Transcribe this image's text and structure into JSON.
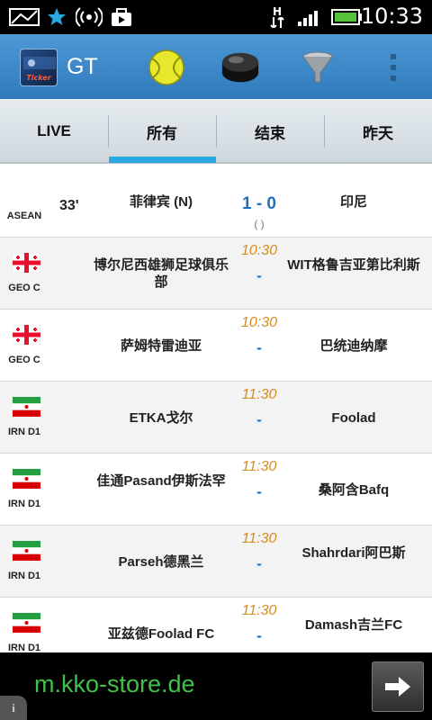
{
  "statusbar": {
    "time": "10:33",
    "icons": [
      "image-icon",
      "star-icon",
      "hotspot-icon",
      "briefcase-icon",
      "data-transfer-icon",
      "signal-icon",
      "battery-icon"
    ],
    "network_letter": "H"
  },
  "appbar": {
    "title": "GT",
    "logo_text": "Ticker",
    "actions": [
      "tennis-ball-icon",
      "hockey-puck-icon",
      "filter-icon",
      "overflow-menu-icon"
    ]
  },
  "tabs": [
    {
      "label": "LIVE",
      "selected": false
    },
    {
      "label": "所有",
      "selected": true
    },
    {
      "label": "结束",
      "selected": false
    },
    {
      "label": "昨天",
      "selected": false
    }
  ],
  "matches": [
    {
      "league": "ASEAN",
      "flag": "",
      "minute": "33'",
      "home": "菲律宾 (N)",
      "away": "印尼",
      "score": "1 - 0",
      "subscore": "( )",
      "time": ""
    },
    {
      "league": "GEO C",
      "flag": "georgia",
      "minute": "",
      "home": "博尔尼西雄狮足球俱乐部",
      "away": "WIT格鲁吉亚第比利斯",
      "score": "",
      "subscore": "",
      "time": "10:30",
      "dash": "-"
    },
    {
      "league": "GEO C",
      "flag": "georgia",
      "minute": "",
      "home": "萨姆特雷迪亚",
      "away": "巴统迪纳摩",
      "score": "",
      "subscore": "",
      "time": "10:30",
      "dash": "-"
    },
    {
      "league": "IRN D1",
      "flag": "iran",
      "minute": "",
      "home": "ETKA戈尔",
      "away": "Foolad",
      "score": "",
      "subscore": "",
      "time": "11:30",
      "dash": "-"
    },
    {
      "league": "IRN D1",
      "flag": "iran",
      "minute": "",
      "home": "佳通Pasand伊斯法罕",
      "away": "桑阿含Bafq",
      "score": "",
      "subscore": "",
      "time": "11:30",
      "dash": "-"
    },
    {
      "league": "IRN D1",
      "flag": "iran",
      "minute": "",
      "home": "Parseh德黑兰",
      "away": "Shahrdari阿巴斯",
      "score": "",
      "subscore": "",
      "time": "11:30",
      "dash": "-"
    },
    {
      "league": "IRN D1",
      "flag": "iran",
      "minute": "",
      "home": "亚兹德Foolad FC",
      "away": "Damash吉兰FC",
      "score": "",
      "subscore": "",
      "time": "11:30",
      "dash": "-"
    }
  ],
  "ad": {
    "text": "m.kko-store.de",
    "info": "i"
  },
  "colors": {
    "appbar": "#3a86c8",
    "tab_indicator": "#2aa9e0",
    "score": "#1f6fc0",
    "kickoff_time": "#d88c20",
    "ad_text": "#40c24a"
  }
}
